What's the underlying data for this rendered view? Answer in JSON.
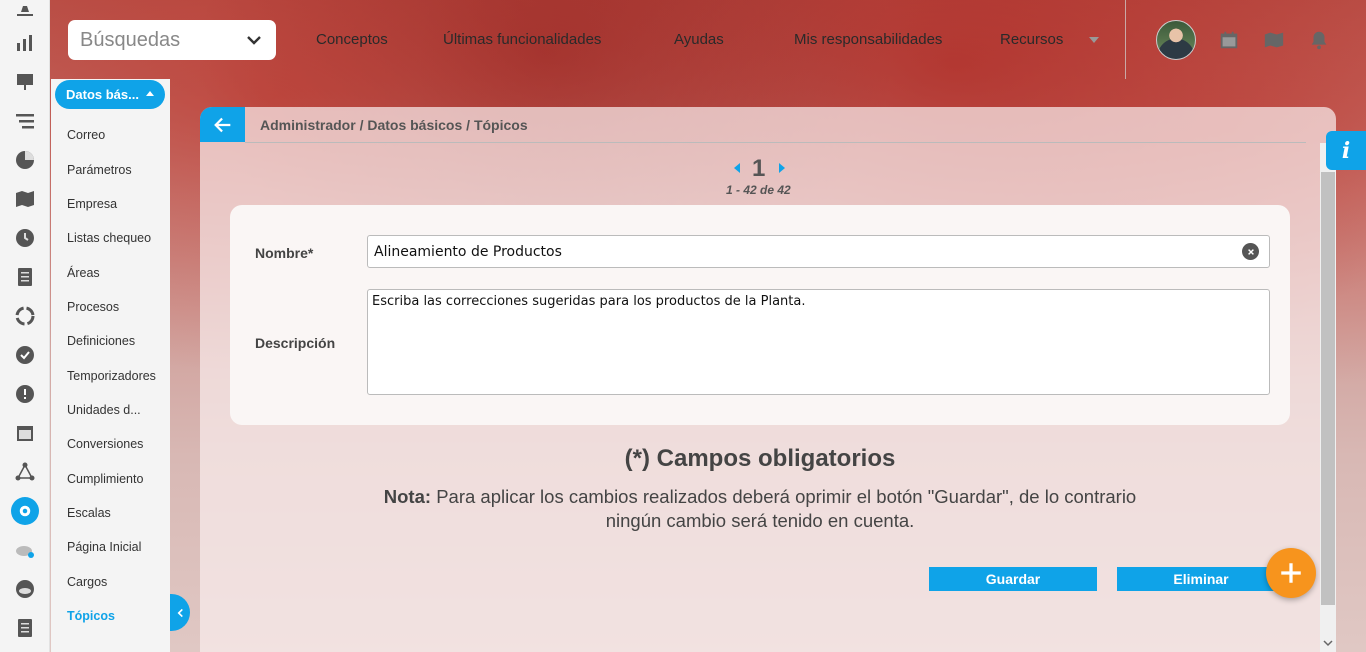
{
  "topbar": {
    "search_placeholder": "Búsquedas",
    "nav": [
      "Conceptos",
      "Últimas funcionalidades",
      "Ayudas",
      "Mis responsabilidades",
      "Recursos"
    ]
  },
  "sidebar": {
    "header": "Datos bás...",
    "items": [
      "Correo",
      "Parámetros",
      "Empresa",
      "Listas chequeo",
      "Áreas",
      "Procesos",
      "Definiciones",
      "Temporizadores",
      "Unidades d...",
      "Conversiones",
      "Cumplimiento",
      "Escalas",
      "Página Inicial",
      "Cargos",
      "Tópicos"
    ],
    "active": "Tópicos"
  },
  "breadcrumb": "Administrador / Datos básicos / Tópicos",
  "pager": {
    "current": "1",
    "range": "1 - 42 de 42"
  },
  "form": {
    "name_label": "Nombre*",
    "name_value": "Alineamiento de Productos",
    "desc_label": "Descripción",
    "desc_value": "Escriba las correcciones sugeridas para los productos de la Planta."
  },
  "required_text": "(*) Campos obligatorios",
  "note": {
    "prefix": "Nota:",
    "text": "Para aplicar los cambios realizados deberá oprimir el botón \"Guardar\", de lo contrario ningún cambio será tenido en cuenta."
  },
  "buttons": {
    "save": "Guardar",
    "delete": "Eliminar"
  },
  "info_label": "i",
  "colors": {
    "accent": "#0fa3e8",
    "fab": "#f7941d"
  }
}
